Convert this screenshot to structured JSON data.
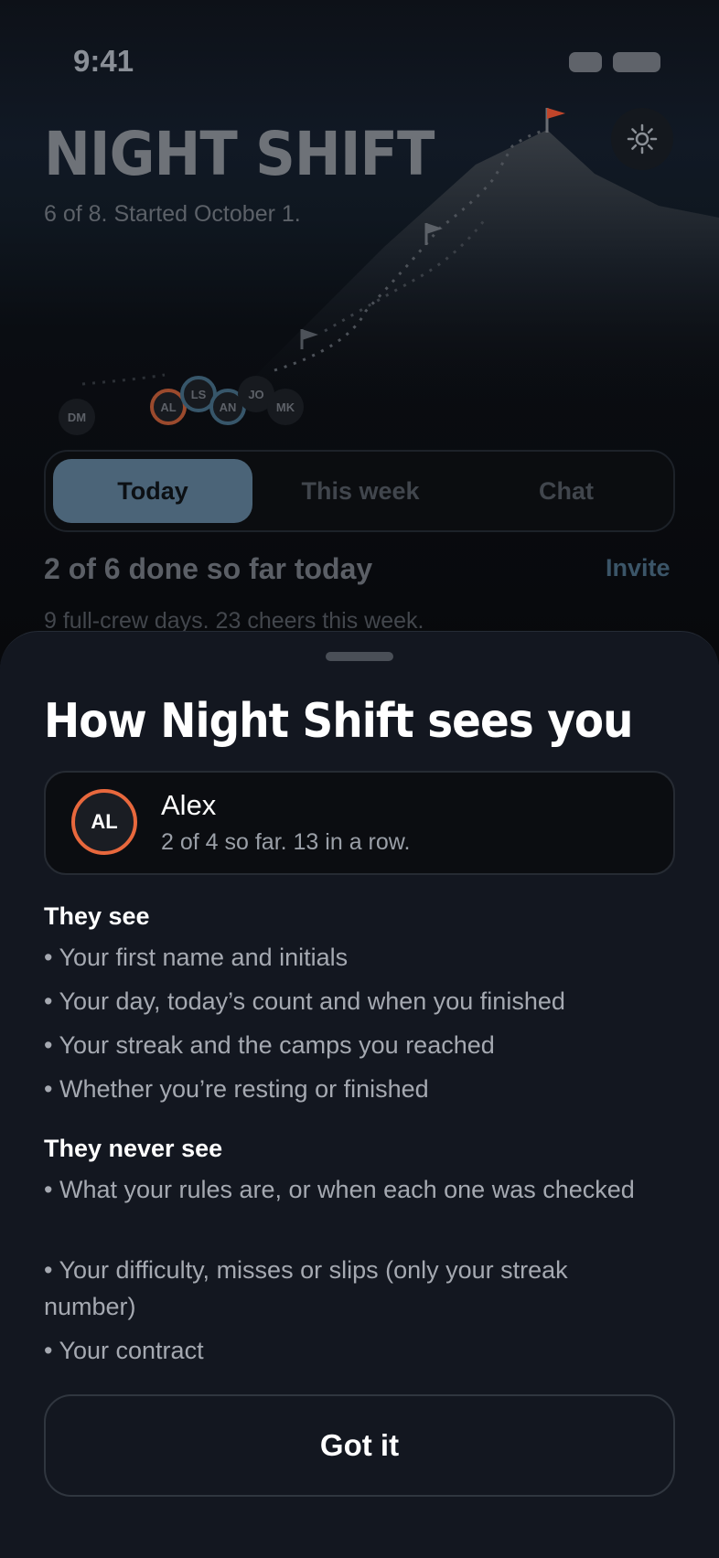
{
  "status_bar": {
    "time": "9:41"
  },
  "header": {
    "title": "NIGHT SHIFT",
    "subtitle": "6 of 8. Started October 1."
  },
  "crew": {
    "avatars": [
      {
        "initials": "DM"
      },
      {
        "initials": "AL"
      },
      {
        "initials": "LS"
      },
      {
        "initials": "AN"
      },
      {
        "initials": "JO"
      },
      {
        "initials": "MK"
      }
    ]
  },
  "tabs": [
    {
      "label": "Today",
      "active": true
    },
    {
      "label": "This week",
      "active": false
    },
    {
      "label": "Chat",
      "active": false
    }
  ],
  "today": {
    "progress": "2 of 6 done so far today",
    "invite_label": "Invite",
    "week_summary": "9 full-crew days. 23 cheers this week."
  },
  "sheet": {
    "title": "How Night Shift sees you",
    "profile": {
      "initials": "AL",
      "name": "Alex",
      "detail": "2 of 4 so far. 13 in a row."
    },
    "they_see": {
      "heading": "They see",
      "items": [
        "• Your first name and initials",
        "• Your day, today’s count and when you finished",
        "• Your streak and the camps you reached",
        "• Whether you’re resting or finished"
      ]
    },
    "they_never_see": {
      "heading": "They never see",
      "items": [
        "• What your rules are, or when each one was checked",
        "• Your difficulty, misses or slips (only your streak number)",
        "• Your contract"
      ]
    },
    "button_label": "Got it"
  },
  "colors": {
    "accent_blue": "#4b6478",
    "accent_orange": "#e8683d",
    "sheet_bg": "#131720",
    "flag_red": "#c0452a"
  }
}
